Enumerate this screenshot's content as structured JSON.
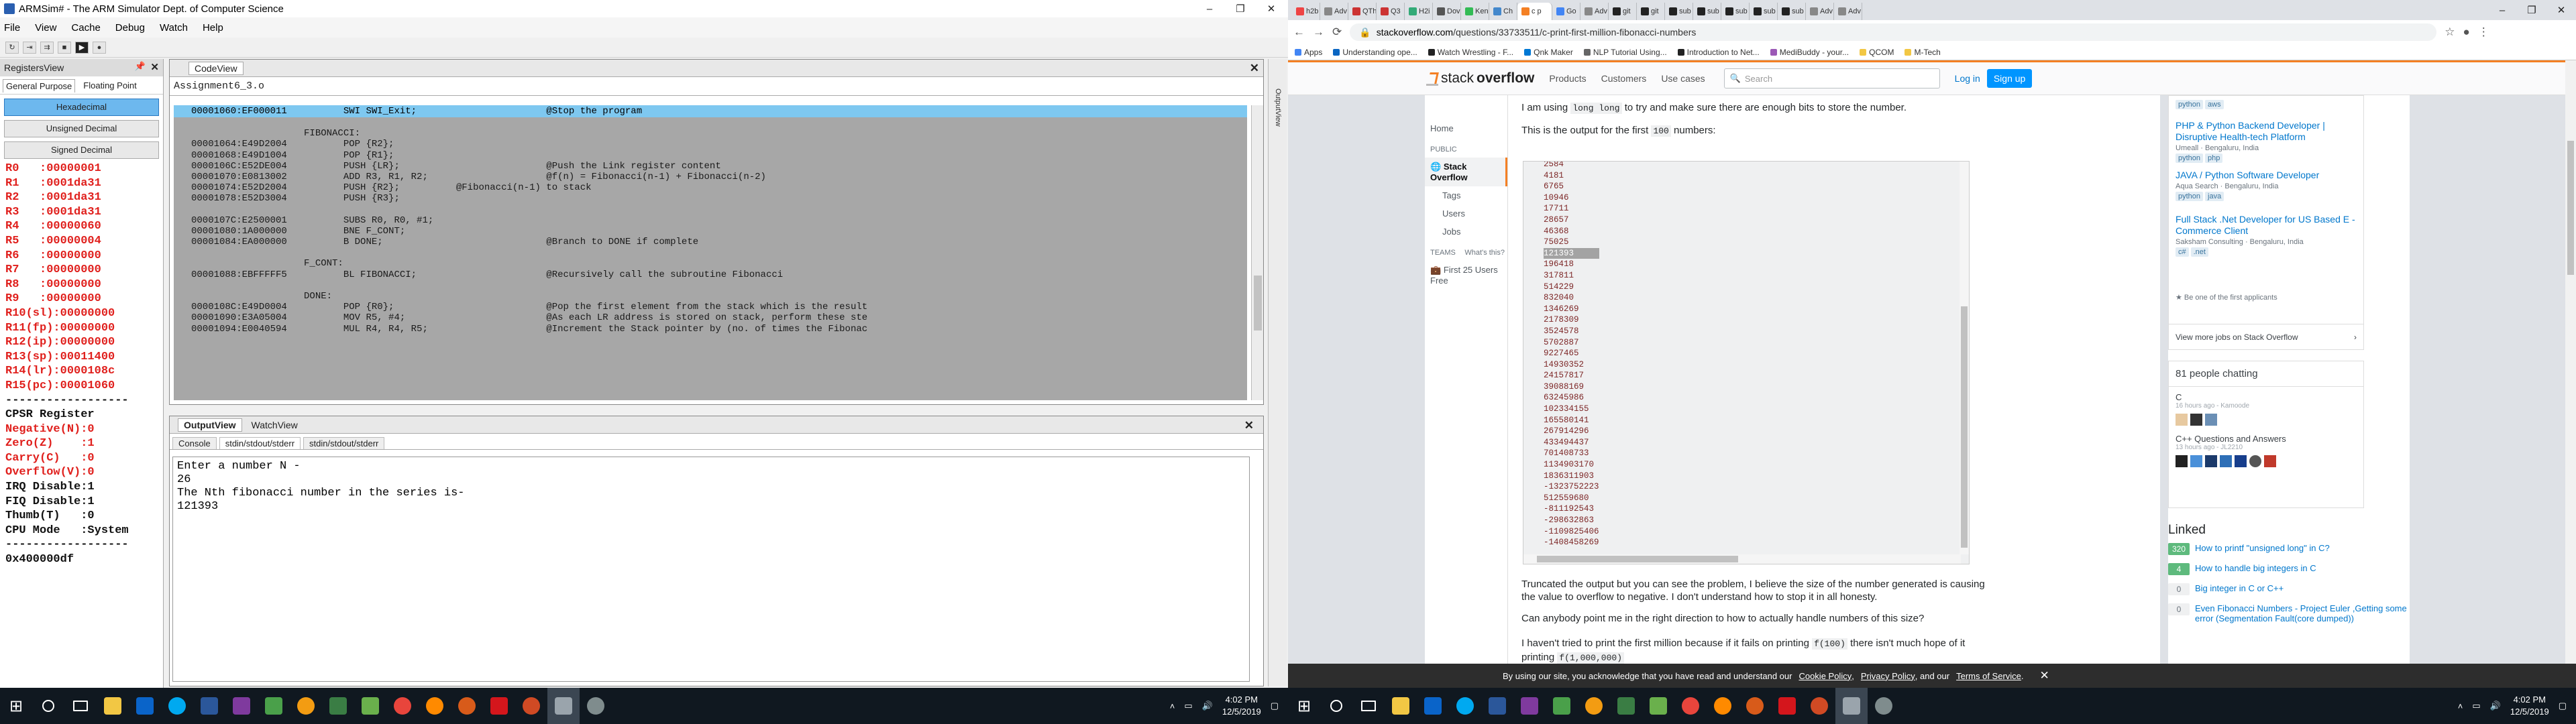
{
  "left": {
    "title": "ARMSim# - The ARM Simulator Dept. of Computer Science",
    "menu": [
      "File",
      "View",
      "Cache",
      "Debug",
      "Watch",
      "Help"
    ],
    "registers": {
      "panel_title": "RegistersView",
      "tabs": [
        "General Purpose",
        "Floating Point"
      ],
      "formats": [
        "Hexadecimal",
        "Unsigned Decimal",
        "Signed Decimal"
      ],
      "lines": [
        "R0   :00000001",
        "R1   :0001da31",
        "R2   :0001da31",
        "R3   :0001da31",
        "R4   :00000060",
        "R5   :00000004",
        "R6   :00000000",
        "R7   :00000000",
        "R8   :00000000",
        "R9   :00000000",
        "R10(sl):00000000",
        "R11(fp):00000000",
        "R12(ip):00000000",
        "R13(sp):00011400",
        "R14(lr):0000108c",
        "R15(pc):00001060",
        "------------------",
        "CPSR Register",
        "Negative(N):0",
        "Zero(Z)    :1",
        "Carry(C)   :0",
        "Overflow(V):0",
        "IRQ Disable:1",
        "FIQ Disable:1",
        "Thumb(T)   :0",
        "CPU Mode   :System",
        "------------------",
        "0x400000df"
      ]
    },
    "code": {
      "tab": "CodeView",
      "file": "Assignment6_3.o",
      "lines": [
        "00001060:EF000011          SWI SWI_Exit;                       @Stop the program",
        "",
        "                    FIBONACCI:",
        "00001064:E49D2004          POP {R2};",
        "00001068:E49D1004          POP {R1};",
        "0000106C:E52DE004          PUSH {LR};                          @Push the Link register content",
        "00001070:E0813002          ADD R3, R1, R2;                     @f(n) = Fibonacci(n-1) + Fibonacci(n-2)",
        "00001074:E52D2004          PUSH {R2};          @Fibonacci(n-1) to stack",
        "00001078:E52D3004          PUSH {R3};",
        "",
        "0000107C:E2500001          SUBS R0, R0, #1;",
        "00001080:1A000000          BNE F_CONT;",
        "00001084:EA000000          B DONE;                             @Branch to DONE if complete",
        "",
        "                    F_CONT:",
        "00001088:EBFFFFF5          BL FIBONACCI;                       @Recursively call the subroutine Fibonacci",
        "",
        "                    DONE:",
        "0000108C:E49D0004          POP {R0};                           @Pop the first element from the stack which is the result",
        "00001090:E3A05004          MOV R5, #4;                         @As each LR address is stored on stack, perform these ste",
        "00001094:E0040594          MUL R4, R4, R5;                     @Increment the Stack pointer by (no. of times the Fibonac"
      ]
    },
    "output": {
      "tabs": [
        "OutputView",
        "WatchView"
      ],
      "subtabs": [
        "Console",
        "stdin/stdout/stderr",
        "stdin/stdout/stderr"
      ],
      "console_text": "Enter a number N -\n26\nThe Nth fibonacci number in the series is-\n121393"
    },
    "side_strip": "OutputView",
    "clock_time": "4:02 PM",
    "clock_date": "12/5/2019"
  },
  "right": {
    "tabs": [
      "h2b",
      "Adv",
      "QTh",
      "Q3",
      "H2i",
      "Dov",
      "Ken",
      "Ch",
      "c p",
      "Go",
      "Adv",
      "git",
      "git",
      "sub",
      "sub",
      "sub",
      "sub",
      "sub",
      "Adv",
      "Adv"
    ],
    "url_host": "stackoverflow.com",
    "url_path": "/questions/33733511/c-print-first-million-fibonacci-numbers",
    "bookmarks": [
      "Apps",
      "Understanding ope...",
      "Watch Wrestling - F...",
      "Qnk Maker",
      "NLP Tutorial Using...",
      "Introduction to Net...",
      "MediBuddy - your...",
      "QCOM",
      "M-Tech"
    ],
    "so_nav": [
      "Products",
      "Customers",
      "Use cases"
    ],
    "search_placeholder": "Search",
    "login": "Log in",
    "signup": "Sign up",
    "leftnav": {
      "home": "Home",
      "public": "PUBLIC",
      "stack_overflow": "Stack Overflow",
      "tags": "Tags",
      "users": "Users",
      "jobs": "Jobs",
      "teams": "TEAMS",
      "whats_this": "What's this?",
      "first25": "First 25 Users Free"
    },
    "question": {
      "p1_before": "I am using",
      "p1_code": "long long",
      "p1_after": "to try and make sure there are enough bits to store the number.",
      "p2_before": "This is the output for the first",
      "p2_code": "100",
      "p2_after": "numbers:",
      "output_numbers": [
        "2584",
        "4181",
        "6765",
        "10946",
        "17711",
        "28657",
        "46368",
        "75025",
        "121393",
        "196418",
        "317811",
        "514229",
        "832040",
        "1346269",
        "2178309",
        "3524578",
        "5702887",
        "9227465",
        "14930352",
        "24157817",
        "39088169",
        "63245986",
        "102334155",
        "165580141",
        "267914296",
        "433494437",
        "701408733",
        "1134903170",
        "1836311903",
        "-1323752223",
        "512559680",
        "-811192543",
        "-298632863",
        "-1109825406",
        "-1408458269",
        "..."
      ],
      "p3": "Truncated the output but you can see the problem, I believe the size of the number generated is causing the value to overflow to negative. I don't understand how to stop it in all honesty.",
      "p4": "Can anybody point me in the right direction to how to actually handle numbers of this size?",
      "p5_before": "I haven't tried to print the first million because if it fails on printing",
      "p5_code1": "f(100)",
      "p5_mid": "there isn't much hope of it printing",
      "p5_code2": "f(1,000,000)"
    },
    "jobs": [
      {
        "title": "",
        "company": "",
        "tags": [
          "python",
          "aws"
        ]
      },
      {
        "title": "PHP & Python Backend Developer | Disruptive Health-tech Platform",
        "company": "Umeall · Bengaluru, India",
        "tags": [
          "python",
          "php"
        ]
      },
      {
        "title": "JAVA / Python Software Developer",
        "company": "Aqua Search · Bengaluru, India",
        "tags": [
          "python",
          "java"
        ]
      },
      {
        "title": "Full Stack .Net Developer for US Based E - Commerce Client",
        "company": "Saksham Consulting · Bengaluru, India",
        "tags": [
          "c#",
          ".net"
        ]
      }
    ],
    "be_first": "Be one of the first applicants",
    "view_more": "View more jobs on Stack Overflow",
    "chat": {
      "title": "81 people chatting",
      "room1": "C",
      "room1_meta": "16 hours ago - Kamoode",
      "room2": "C++ Questions and Answers",
      "room2_meta": "13 hours ago - JL2210"
    },
    "linked": {
      "title": "Linked",
      "items": [
        {
          "n": "320",
          "text": "How to printf \"unsigned long\" in C?",
          "green": true
        },
        {
          "n": "4",
          "text": "How to handle big integers in C",
          "green": true
        },
        {
          "n": "0",
          "text": "Big integer in C or C++",
          "green": false
        },
        {
          "n": "0",
          "text": "Even Fibonacci Numbers - Project Euler ,Getting some error (Segmentation Fault(core dumped))",
          "green": false
        }
      ]
    },
    "cookie": {
      "before": "By using our site, you acknowledge that you have read and understand our",
      "l1": "Cookie Policy",
      "comma": ",",
      "l2": "Privacy Policy",
      "and": ", and our",
      "l3": "Terms of Service",
      "end": "."
    },
    "clock_time": "4:02 PM",
    "clock_date": "12/5/2019"
  },
  "colors": {
    "register_red": "#e0201d",
    "highlight_line": "#7ec8f0",
    "so_orange": "#f48024",
    "so_blue": "#0095ff"
  }
}
